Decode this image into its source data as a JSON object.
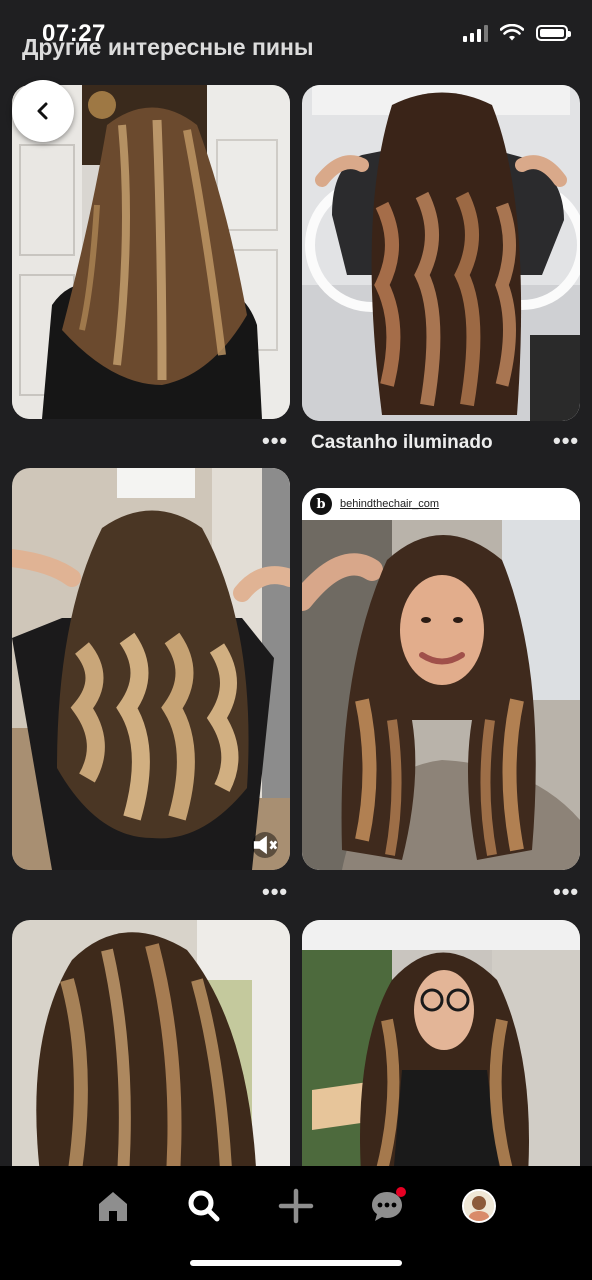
{
  "status": {
    "time": "07:27"
  },
  "header": {
    "title": "Другие интересные пины"
  },
  "pins": [
    {
      "title": "",
      "more": "•••"
    },
    {
      "title": "Castanho iluminado",
      "more": "•••"
    },
    {
      "title": "",
      "more": "•••"
    },
    {
      "title": "",
      "more": "•••",
      "source": "behindthechair_com",
      "source_logo": "b"
    },
    {
      "title": ""
    },
    {
      "title": ""
    }
  ],
  "nav": {
    "items": [
      "home-icon",
      "search-icon",
      "plus-icon",
      "messages-icon",
      "profile-avatar"
    ],
    "accent": "#e60023"
  }
}
